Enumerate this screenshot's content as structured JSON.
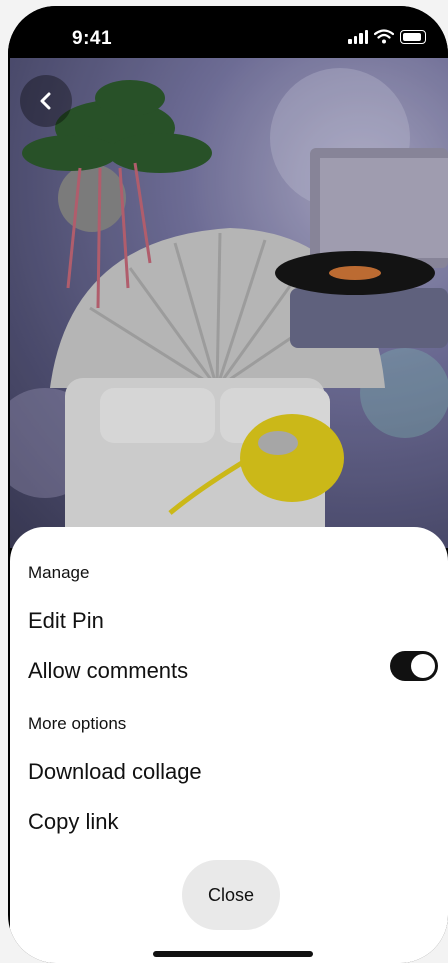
{
  "status": {
    "time": "9:41"
  },
  "sheet": {
    "section_manage": "Manage",
    "edit_pin": "Edit Pin",
    "allow_comments": "Allow comments",
    "allow_comments_enabled": true,
    "section_more": "More options",
    "download_collage": "Download collage",
    "copy_link": "Copy link",
    "close": "Close"
  },
  "icons": {
    "back": "chevron-left-icon",
    "signal": "signal-icon",
    "wifi": "wifi-icon",
    "battery": "battery-icon"
  }
}
